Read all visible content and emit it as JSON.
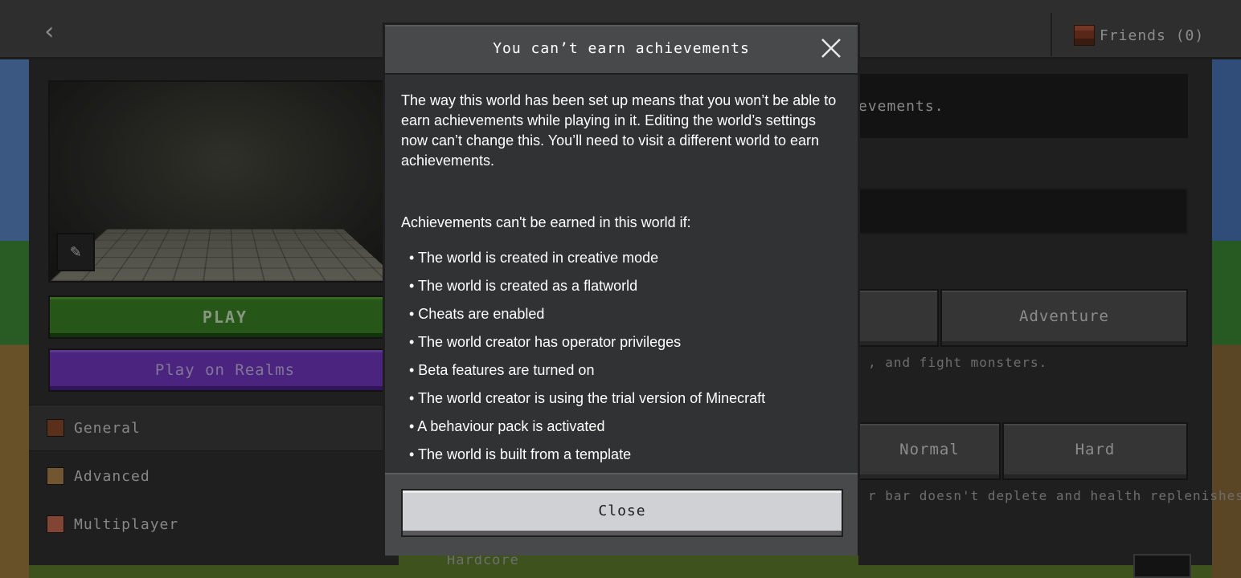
{
  "topbar": {
    "back_label": "‹",
    "friends_label": "Friends (0)"
  },
  "left_panel": {
    "play_label": "PLAY",
    "realms_label": "Play on Realms",
    "nav": [
      {
        "label": "General",
        "icon": "general-icon"
      },
      {
        "label": "Advanced",
        "icon": "advanced-icon"
      },
      {
        "label": "Multiplayer",
        "icon": "multiplayer-icon"
      }
    ]
  },
  "right_panel": {
    "banner_text": "evements.",
    "mode_button": "Adventure",
    "mode_caption": ", and fight monsters.",
    "difficulty_normal": "Normal",
    "difficulty_hard": "Hard",
    "difficulty_caption": "r bar doesn't deplete and health replenishes",
    "hardcore_label": "Hardcore"
  },
  "modal": {
    "title": "You can’t earn achievements",
    "intro": "The way this world has been set up means that you won’t be able to earn achievements while playing in it. Editing the world’s settings now can’t change this. You’ll need to visit a different world to earn achievements.",
    "subheading": "Achievements can't be earned in this world if:",
    "bullets": [
      "• The world is created in creative mode",
      "• The world is created as a flatworld",
      "• Cheats are enabled",
      "• The world creator has operator privileges",
      "• Beta features are turned on",
      "• The world creator is using the trial version of Minecraft",
      "• A behaviour pack is activated",
      "• The world is built from a template"
    ],
    "close_button": "Close"
  },
  "colors": {
    "play_green": "#3c8527",
    "realms_purple": "#7238c4",
    "modal_bg": "#313233",
    "modal_header": "#48494a",
    "close_button": "#d0d1d4"
  }
}
